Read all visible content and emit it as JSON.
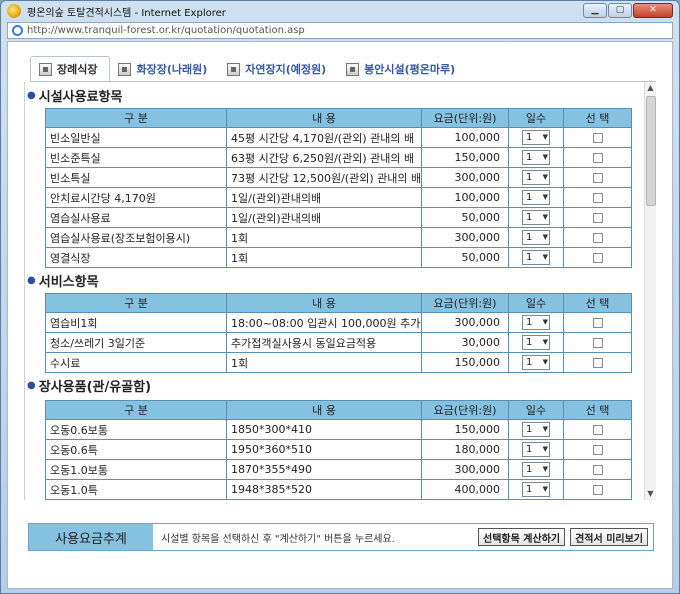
{
  "window": {
    "title": "평온의숲 토탈견적시스템 - Internet Explorer"
  },
  "address": {
    "url": "http://www.tranquil-forest.or.kr/quotation/quotation.asp"
  },
  "tabs": [
    {
      "label": "장례식장"
    },
    {
      "label": "화장장(나래원)"
    },
    {
      "label": "자연장지(예정원)"
    },
    {
      "label": "봉안시설(평온마루)"
    }
  ],
  "headers": {
    "category": "구 분",
    "content": "내 용",
    "price": "요금(단위:원)",
    "days": "일수",
    "select": "선 택"
  },
  "sections": {
    "facility": {
      "title": "시설사용료항목",
      "rows": [
        {
          "name": "빈소일반실",
          "desc": "45평 시간당 4,170원/(관외) 관내의 배",
          "price": "100,000",
          "days": "1"
        },
        {
          "name": "빈소준특실",
          "desc": "63평 시간당 6,250원/(관외) 관내의 배",
          "price": "150,000",
          "days": "1"
        },
        {
          "name": "빈소특실",
          "desc": "73평 시간당 12,500원/(관외) 관내의 배",
          "price": "300,000",
          "days": "1"
        },
        {
          "name": "안치료시간당 4,170원",
          "desc": "1일/(관외)관내의배",
          "price": "100,000",
          "days": "1"
        },
        {
          "name": "염습실사용료",
          "desc": "1일/(관외)관내의배",
          "price": "50,000",
          "days": "1"
        },
        {
          "name": "염습실사용료(장조보험이용시)",
          "desc": "1회",
          "price": "300,000",
          "days": "1"
        },
        {
          "name": "영결식장",
          "desc": "1회",
          "price": "50,000",
          "days": "1"
        }
      ]
    },
    "service": {
      "title": "서비스항목",
      "rows": [
        {
          "name": "염습비1회",
          "desc": "18:00~08:00 입관시 100,000원 추가",
          "price": "300,000",
          "days": "1"
        },
        {
          "name": "청소/쓰레기 3일기준",
          "desc": "추가접객실사용시 동일요금적용",
          "price": "30,000",
          "days": "1"
        },
        {
          "name": "수시료",
          "desc": "1회",
          "price": "150,000",
          "days": "1"
        }
      ]
    },
    "supplies": {
      "title": "장사용품(관/유골함)",
      "rows": [
        {
          "name": "오동0.6보통",
          "desc": "1850*300*410",
          "price": "150,000",
          "days": "1"
        },
        {
          "name": "오동0.6특",
          "desc": "1950*360*510",
          "price": "180,000",
          "days": "1"
        },
        {
          "name": "오동1.0보통",
          "desc": "1870*355*490",
          "price": "300,000",
          "days": "1"
        },
        {
          "name": "오동1.0특",
          "desc": "1948*385*520",
          "price": "400,000",
          "days": "1"
        }
      ]
    }
  },
  "footer": {
    "label": "사용요금추계",
    "message": "시설별 항목을 선택하신 후 \"계산하기\" 버튼을 누르세요.",
    "calc_button": "선택항목 계산하기",
    "preview_button": "견적서 미리보기"
  }
}
